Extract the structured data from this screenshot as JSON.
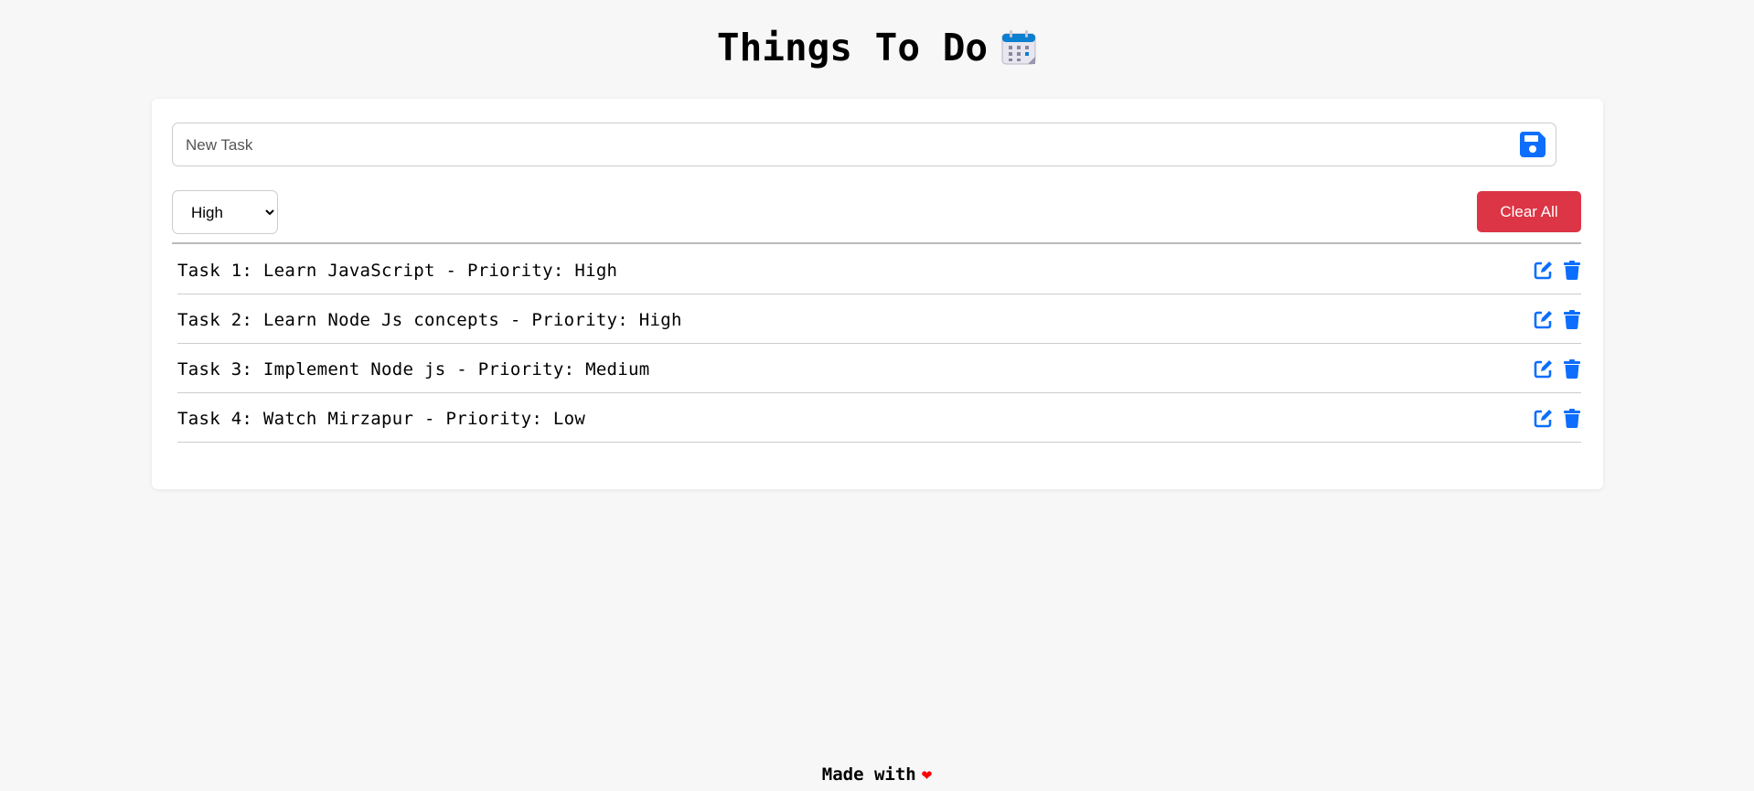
{
  "header": {
    "title": "Things To Do",
    "icon": "calendar-icon"
  },
  "form": {
    "task_placeholder": "New Task",
    "task_value": "",
    "save_icon": "floppy-disk-icon",
    "priority_selected": "High",
    "clear_all_label": "Clear All"
  },
  "tasks": [
    {
      "text": "Task 1: Learn JavaScript - Priority: High"
    },
    {
      "text": "Task 2: Learn Node Js concepts - Priority: High"
    },
    {
      "text": "Task 3: Implement Node js - Priority: Medium"
    },
    {
      "text": "Task 4: Watch Mirzapur - Priority: Low"
    }
  ],
  "footer": {
    "text": "Made with",
    "heart": "❤"
  },
  "colors": {
    "accent": "#0d6efd",
    "danger": "#dc3545",
    "heart": "#ff0000"
  }
}
